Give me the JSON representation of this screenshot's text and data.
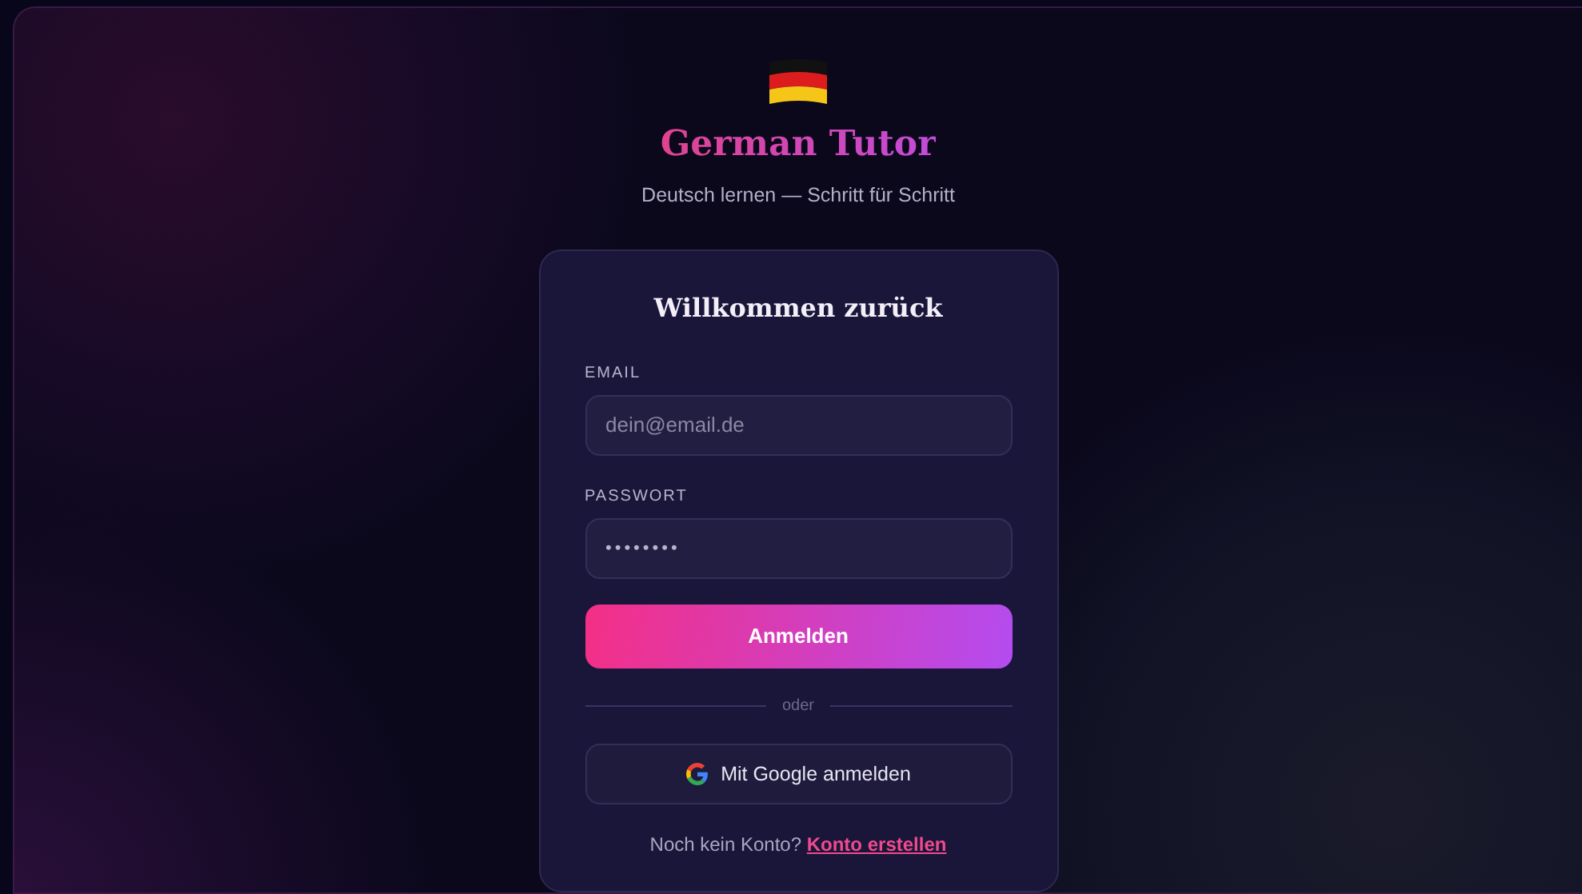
{
  "app": {
    "title": "German Tutor",
    "tagline": "Deutsch lernen — Schritt für Schritt"
  },
  "login": {
    "heading": "Willkommen zurück",
    "fields": [
      {
        "label": "EMAIL",
        "placeholder": "dein@email.de"
      },
      {
        "label": "PASSWORT",
        "value": "••••••••"
      }
    ],
    "submit": "Anmelden",
    "divider": "oder",
    "google_button": "Mit Google anmelden",
    "signup_prompt": "Noch kein Konto?",
    "signup_link": "Konto erstellen"
  }
}
